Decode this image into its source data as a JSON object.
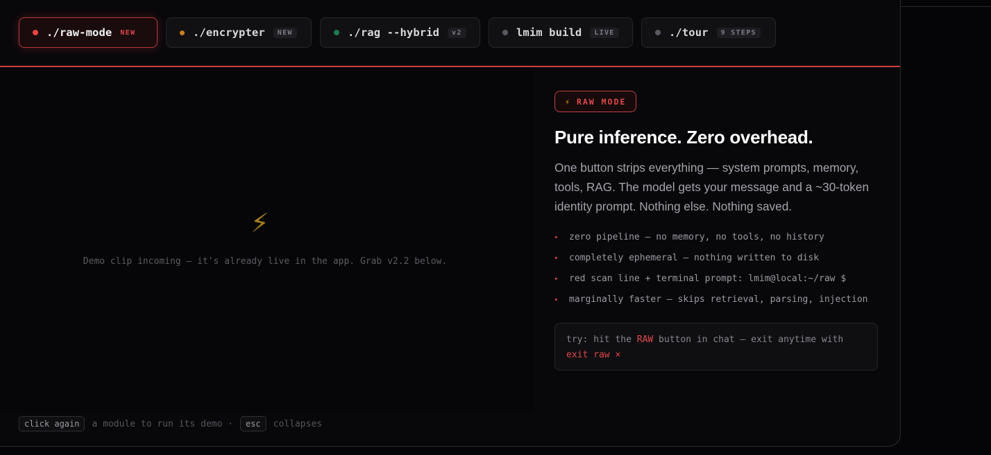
{
  "tabs": [
    {
      "label": "./raw-mode",
      "badge": "NEW",
      "dot_color": "#e84545",
      "active": true
    },
    {
      "label": "./encrypter",
      "badge": "NEW",
      "dot_color": "#c8801e",
      "active": false
    },
    {
      "label": "./rag --hybrid",
      "badge": "v2",
      "dot_color": "#1e7a4e",
      "active": false
    },
    {
      "label": "lmim build",
      "badge": "LIVE",
      "dot_color": "#5a5a62",
      "active": false
    },
    {
      "label": "./tour",
      "badge": "9 STEPS",
      "dot_color": "#5a5a62",
      "active": false
    }
  ],
  "media": {
    "icon": "lightning-icon",
    "caption": "Demo clip incoming — it's already live in the app. Grab v2.2 below."
  },
  "info": {
    "pill_icon": "lightning-icon",
    "pill_label": "RAW MODE",
    "headline": "Pure inference. Zero overhead.",
    "description": "One button strips everything — system prompts, memory, tools, RAG. The model gets your message and a ~30-token identity prompt. Nothing else. Nothing saved.",
    "bullets": [
      "zero pipeline — no memory, no tools, no history",
      "completely ephemeral — nothing written to disk",
      "red scan line + terminal prompt: lmim@local:~/raw $",
      "marginally faster — skips retrieval, parsing, injection"
    ],
    "try": {
      "prefix": "try: hit the ",
      "highlight": "RAW",
      "middle": " button in chat — exit anytime with ",
      "exit_label": "exit raw ×"
    }
  },
  "hint": {
    "key1": "click again",
    "text1": "a module to run its demo ·",
    "key2": "esc",
    "text2": "collapses"
  },
  "colors": {
    "accent": "#e0474a",
    "background": "#08080b"
  }
}
